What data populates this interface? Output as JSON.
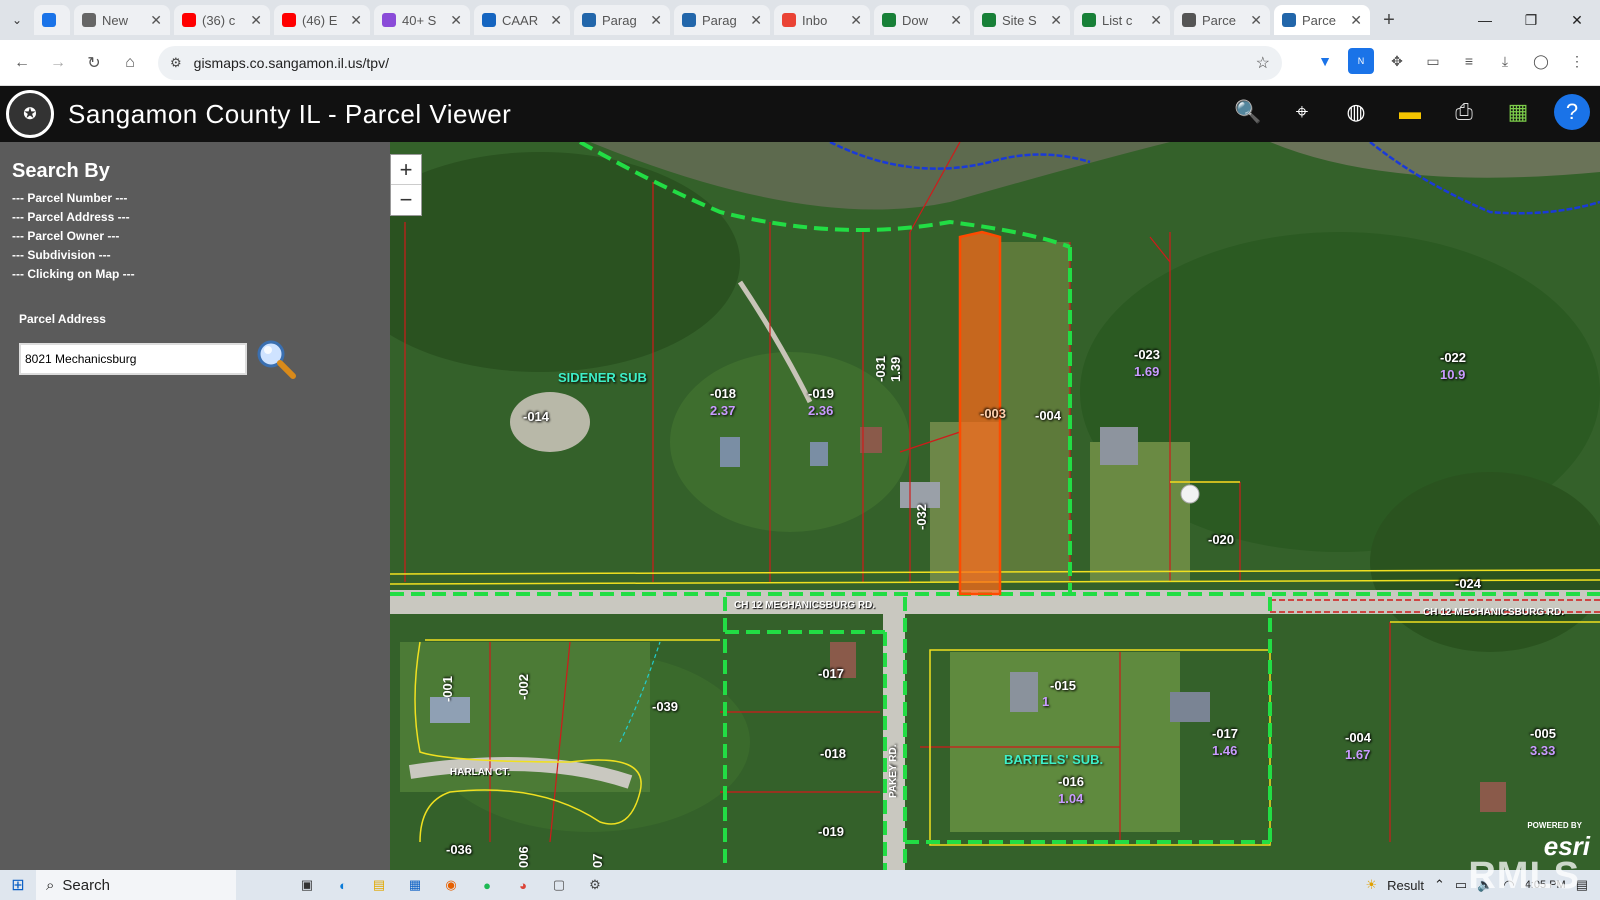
{
  "browser": {
    "tabs": [
      {
        "label": "",
        "color": "#1a73e8",
        "icon": "vpn-icon"
      },
      {
        "label": "New",
        "color": "#666666",
        "icon": "chrome-icon"
      },
      {
        "label": "(36) c",
        "color": "#ff0000",
        "icon": "youtube-icon"
      },
      {
        "label": "(46) E",
        "color": "#ff0000",
        "icon": "youtube-icon"
      },
      {
        "label": "40+ S",
        "color": "#8a4bd8",
        "icon": "bolt-icon"
      },
      {
        "label": "CAAR",
        "color": "#1565c0",
        "icon": "people-icon"
      },
      {
        "label": "Parag",
        "color": "#2266aa",
        "icon": "paragon-icon"
      },
      {
        "label": "Parag",
        "color": "#2266aa",
        "icon": "paragon-icon"
      },
      {
        "label": "Inbo",
        "color": "#ea4335",
        "icon": "gmail-icon"
      },
      {
        "label": "Dow",
        "color": "#188038",
        "icon": "sheets-icon"
      },
      {
        "label": "Site S",
        "color": "#188038",
        "icon": "sheets-icon"
      },
      {
        "label": "List c",
        "color": "#188038",
        "icon": "sheets-icon"
      },
      {
        "label": "Parce",
        "color": "#555555",
        "icon": "globe-icon"
      },
      {
        "label": "Parce",
        "color": "#2266aa",
        "icon": "map-icon",
        "active": true
      }
    ],
    "url": "gismaps.co.sangamon.il.us/tpv/"
  },
  "app": {
    "title": "Sangamon County IL - Parcel Viewer"
  },
  "sidebar": {
    "heading": "Search By",
    "links": [
      "--- Parcel Number ---",
      "--- Parcel Address ---",
      "--- Parcel Owner ---",
      "--- Subdivision ---",
      "--- Clicking on Map ---"
    ],
    "address_label": "Parcel Address",
    "address_value": "8021 Mechanicsburg"
  },
  "map": {
    "zoom_in": "+",
    "zoom_out": "−",
    "parcels": [
      {
        "id": "-014"
      },
      {
        "id": "-018",
        "acres": "2.37"
      },
      {
        "id": "-019",
        "acres": "2.36"
      },
      {
        "id": "-031",
        "acres": "1.39"
      },
      {
        "id": "-003"
      },
      {
        "id": "-004"
      },
      {
        "id": "-023",
        "acres": "1.69"
      },
      {
        "id": "-022",
        "acres": "10.9"
      },
      {
        "id": "-032"
      },
      {
        "id": "-020"
      },
      {
        "id": "-024"
      },
      {
        "id": "-001"
      },
      {
        "id": "-002"
      },
      {
        "id": "-039"
      },
      {
        "id": "-017"
      },
      {
        "id": "-018"
      },
      {
        "id": "-019"
      },
      {
        "id": "-015",
        "acres": "1"
      },
      {
        "id": "-016",
        "acres": "1.04"
      },
      {
        "id": "-017",
        "acres": "1.46"
      },
      {
        "id": "-004",
        "acres": "1.67"
      },
      {
        "id": "-005",
        "acres": "3.33"
      },
      {
        "id": "-036"
      },
      {
        "id": "006"
      },
      {
        "id": "07"
      }
    ],
    "subdivisions": [
      "SIDENER SUB",
      "BARTELS' SUB."
    ],
    "roads": [
      "CH 12 MECHANICSBURG RD.",
      "CH 12 MECHANICSBURG RD.",
      "HARLAN CT.",
      "PAKEY RD."
    ],
    "powered_by": "POWERED BY",
    "esri": "esri",
    "watermark": "RMLS"
  },
  "taskbar": {
    "search": "Search",
    "result": "Result",
    "time": "4:05 PM"
  }
}
